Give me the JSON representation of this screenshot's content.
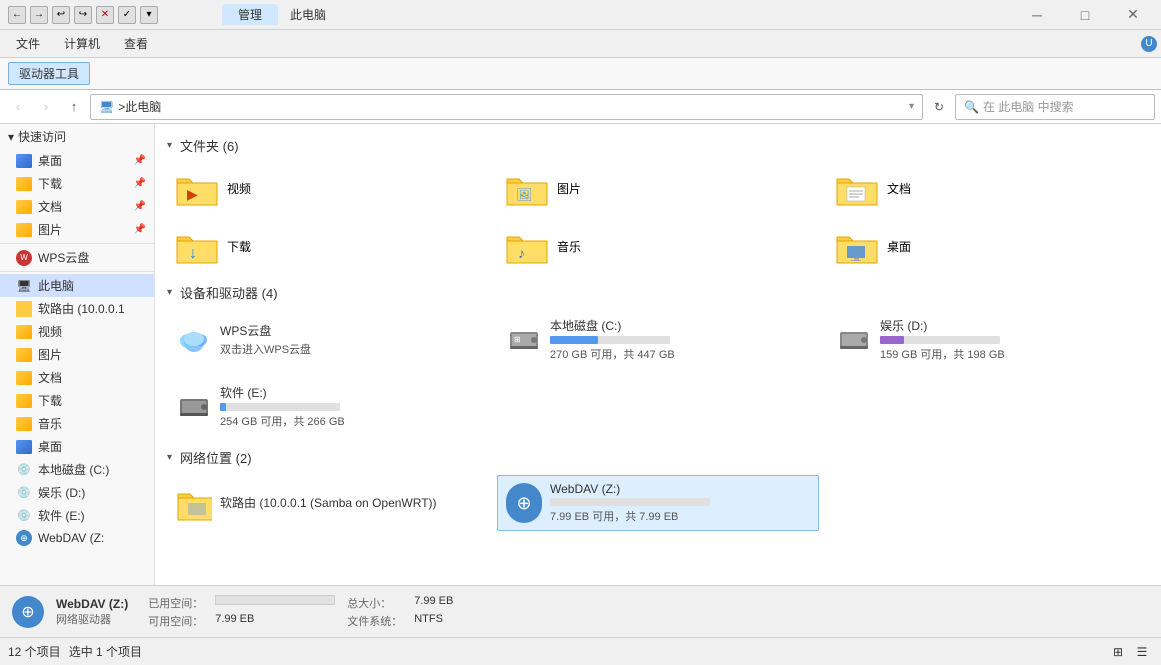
{
  "titlebar": {
    "active_tab": "管理",
    "subtitle": "此电脑",
    "min": "─",
    "max": "□",
    "close": "✕"
  },
  "menubar": {
    "items": [
      "文件",
      "计算机",
      "查看"
    ],
    "active": "驱动器工具"
  },
  "addressbar": {
    "path": "此电脑",
    "search_placeholder": "在 此电脑 中搜索"
  },
  "sidebar": {
    "quick_access": "快速访问",
    "items": [
      {
        "label": "桌面",
        "pinned": true
      },
      {
        "label": "下载",
        "pinned": true
      },
      {
        "label": "文档",
        "pinned": true
      },
      {
        "label": "图片",
        "pinned": true
      }
    ],
    "wps": "WPS云盘",
    "this_pc": "此电脑",
    "sub_items": [
      "软路由 (10.0.0.1",
      "视频",
      "图片",
      "文档",
      "下载",
      "音乐",
      "桌面"
    ],
    "drives": [
      "本地磁盘 (C:)",
      "娱乐 (D:)",
      "软件 (E:)"
    ],
    "webdav_partial": "WebDAV (Z:"
  },
  "sections": {
    "folders": {
      "title": "文件夹",
      "count": "(6)",
      "items": [
        {
          "name": "视频"
        },
        {
          "name": "图片"
        },
        {
          "name": "文档"
        },
        {
          "name": "下载"
        },
        {
          "name": "音乐"
        },
        {
          "name": "桌面"
        }
      ]
    },
    "devices": {
      "title": "设备和驱动器",
      "count": "(4)",
      "items": [
        {
          "name": "WPS云盘",
          "desc": "双击进入WPS云盘",
          "type": "wps"
        },
        {
          "name": "本地磁盘 (C:)",
          "free": "270 GB 可用",
          "total": "共 447 GB",
          "used_pct": 40,
          "type": "drive"
        },
        {
          "name": "娱乐 (D:)",
          "free": "159 GB 可用",
          "total": "共 198 GB",
          "used_pct": 20,
          "type": "drive",
          "bar_color": "purple"
        },
        {
          "name": "软件 (E:)",
          "free": "254 GB 可用",
          "total": "共 266 GB",
          "used_pct": 5,
          "type": "drive"
        }
      ]
    },
    "network": {
      "title": "网络位置",
      "count": "(2)",
      "items": [
        {
          "name": "软路由 (10.0.0.1 (Samba on OpenWRT))",
          "type": "network_folder"
        },
        {
          "name": "WebDAV (Z:)",
          "free": "7.99 EB 可用",
          "total": "共 7.99 EB",
          "used_pct": 0,
          "type": "webdav",
          "active": true
        }
      ]
    }
  },
  "statusbar": {
    "count": "12 个项目",
    "selected": "选中 1 个项目"
  },
  "infobar": {
    "name": "WebDAV (Z:)",
    "type": "网络驱动器",
    "used_label": "已用空间：",
    "free_label": "可用空间：",
    "free_value": "7.99 EB",
    "total_label": "总大小：",
    "total_value": "7.99 EB",
    "fs_label": "文件系统：",
    "fs_value": "NTFS",
    "used_pct": 0
  }
}
